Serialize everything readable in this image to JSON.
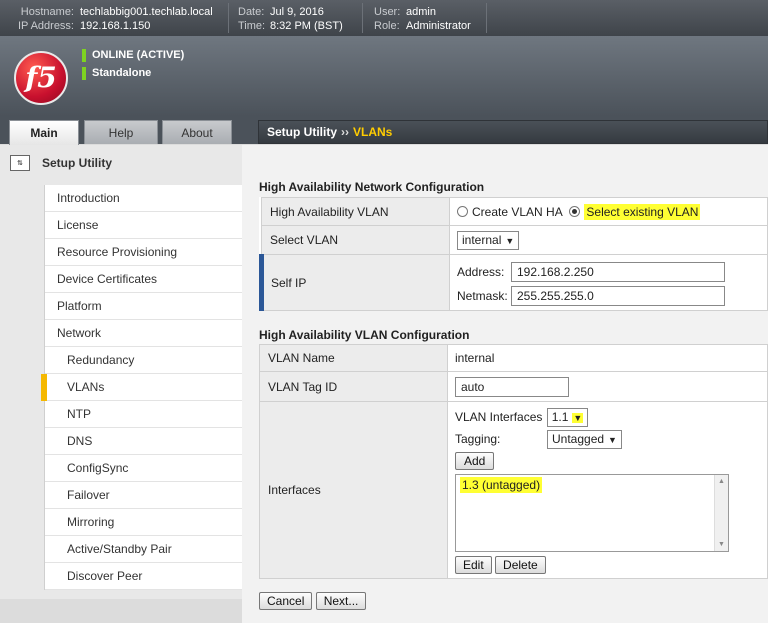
{
  "topbar": {
    "hostname_label": "Hostname:",
    "hostname": "techlabbig001.techlab.local",
    "ip_label": "IP Address:",
    "ip": "192.168.1.150",
    "date_label": "Date:",
    "date": "Jul 9, 2016",
    "time_label": "Time:",
    "time": "8:32 PM (BST)",
    "user_label": "User:",
    "user": "admin",
    "role_label": "Role:",
    "role": "Administrator"
  },
  "header": {
    "logo_text": "f5",
    "status_primary": "ONLINE (ACTIVE)",
    "status_secondary": "Standalone"
  },
  "tabs": [
    {
      "label": "Main",
      "active": true
    },
    {
      "label": "Help",
      "active": false
    },
    {
      "label": "About",
      "active": false
    }
  ],
  "breadcrumb": {
    "section": "Setup Utility",
    "separator": "››",
    "current": "VLANs"
  },
  "sidebar": {
    "title": "Setup Utility",
    "items": [
      {
        "label": "Introduction"
      },
      {
        "label": "License"
      },
      {
        "label": "Resource Provisioning"
      },
      {
        "label": "Device Certificates"
      },
      {
        "label": "Platform"
      },
      {
        "label": "Network"
      },
      {
        "label": "Redundancy"
      },
      {
        "label": "VLANs"
      },
      {
        "label": "NTP"
      },
      {
        "label": "DNS"
      },
      {
        "label": "ConfigSync"
      },
      {
        "label": "Failover"
      },
      {
        "label": "Mirroring"
      },
      {
        "label": "Active/Standby Pair"
      },
      {
        "label": "Discover Peer"
      }
    ]
  },
  "ha_network": {
    "title": "High Availability Network Configuration",
    "ha_vlan_label": "High Availability VLAN",
    "option_create": "Create VLAN HA",
    "option_select": "Select existing VLAN",
    "select_vlan_label": "Select VLAN",
    "select_vlan_value": "internal",
    "self_ip_label": "Self IP",
    "address_label": "Address:",
    "address_value": "192.168.2.250",
    "netmask_label": "Netmask:",
    "netmask_value": "255.255.255.0"
  },
  "ha_vlan": {
    "title": "High Availability VLAN Configuration",
    "vlan_name_label": "VLAN Name",
    "vlan_name_value": "internal",
    "vlan_tag_label": "VLAN Tag ID",
    "vlan_tag_value": "auto",
    "interfaces_label": "Interfaces",
    "vlan_interfaces_label": "VLAN Interfaces",
    "vlan_interfaces_value": "1.1",
    "tagging_label": "Tagging:",
    "tagging_value": "Untagged",
    "add_label": "Add",
    "interfaces_list": [
      "1.3 (untagged)"
    ],
    "edit_label": "Edit",
    "delete_label": "Delete"
  },
  "footer": {
    "cancel_label": "Cancel",
    "next_label": "Next..."
  },
  "colors": {
    "highlight": "#ffff33",
    "accent_yellow": "#ffcc00",
    "status_green": "#7ed321",
    "self_ip_bar": "#2b5797"
  }
}
